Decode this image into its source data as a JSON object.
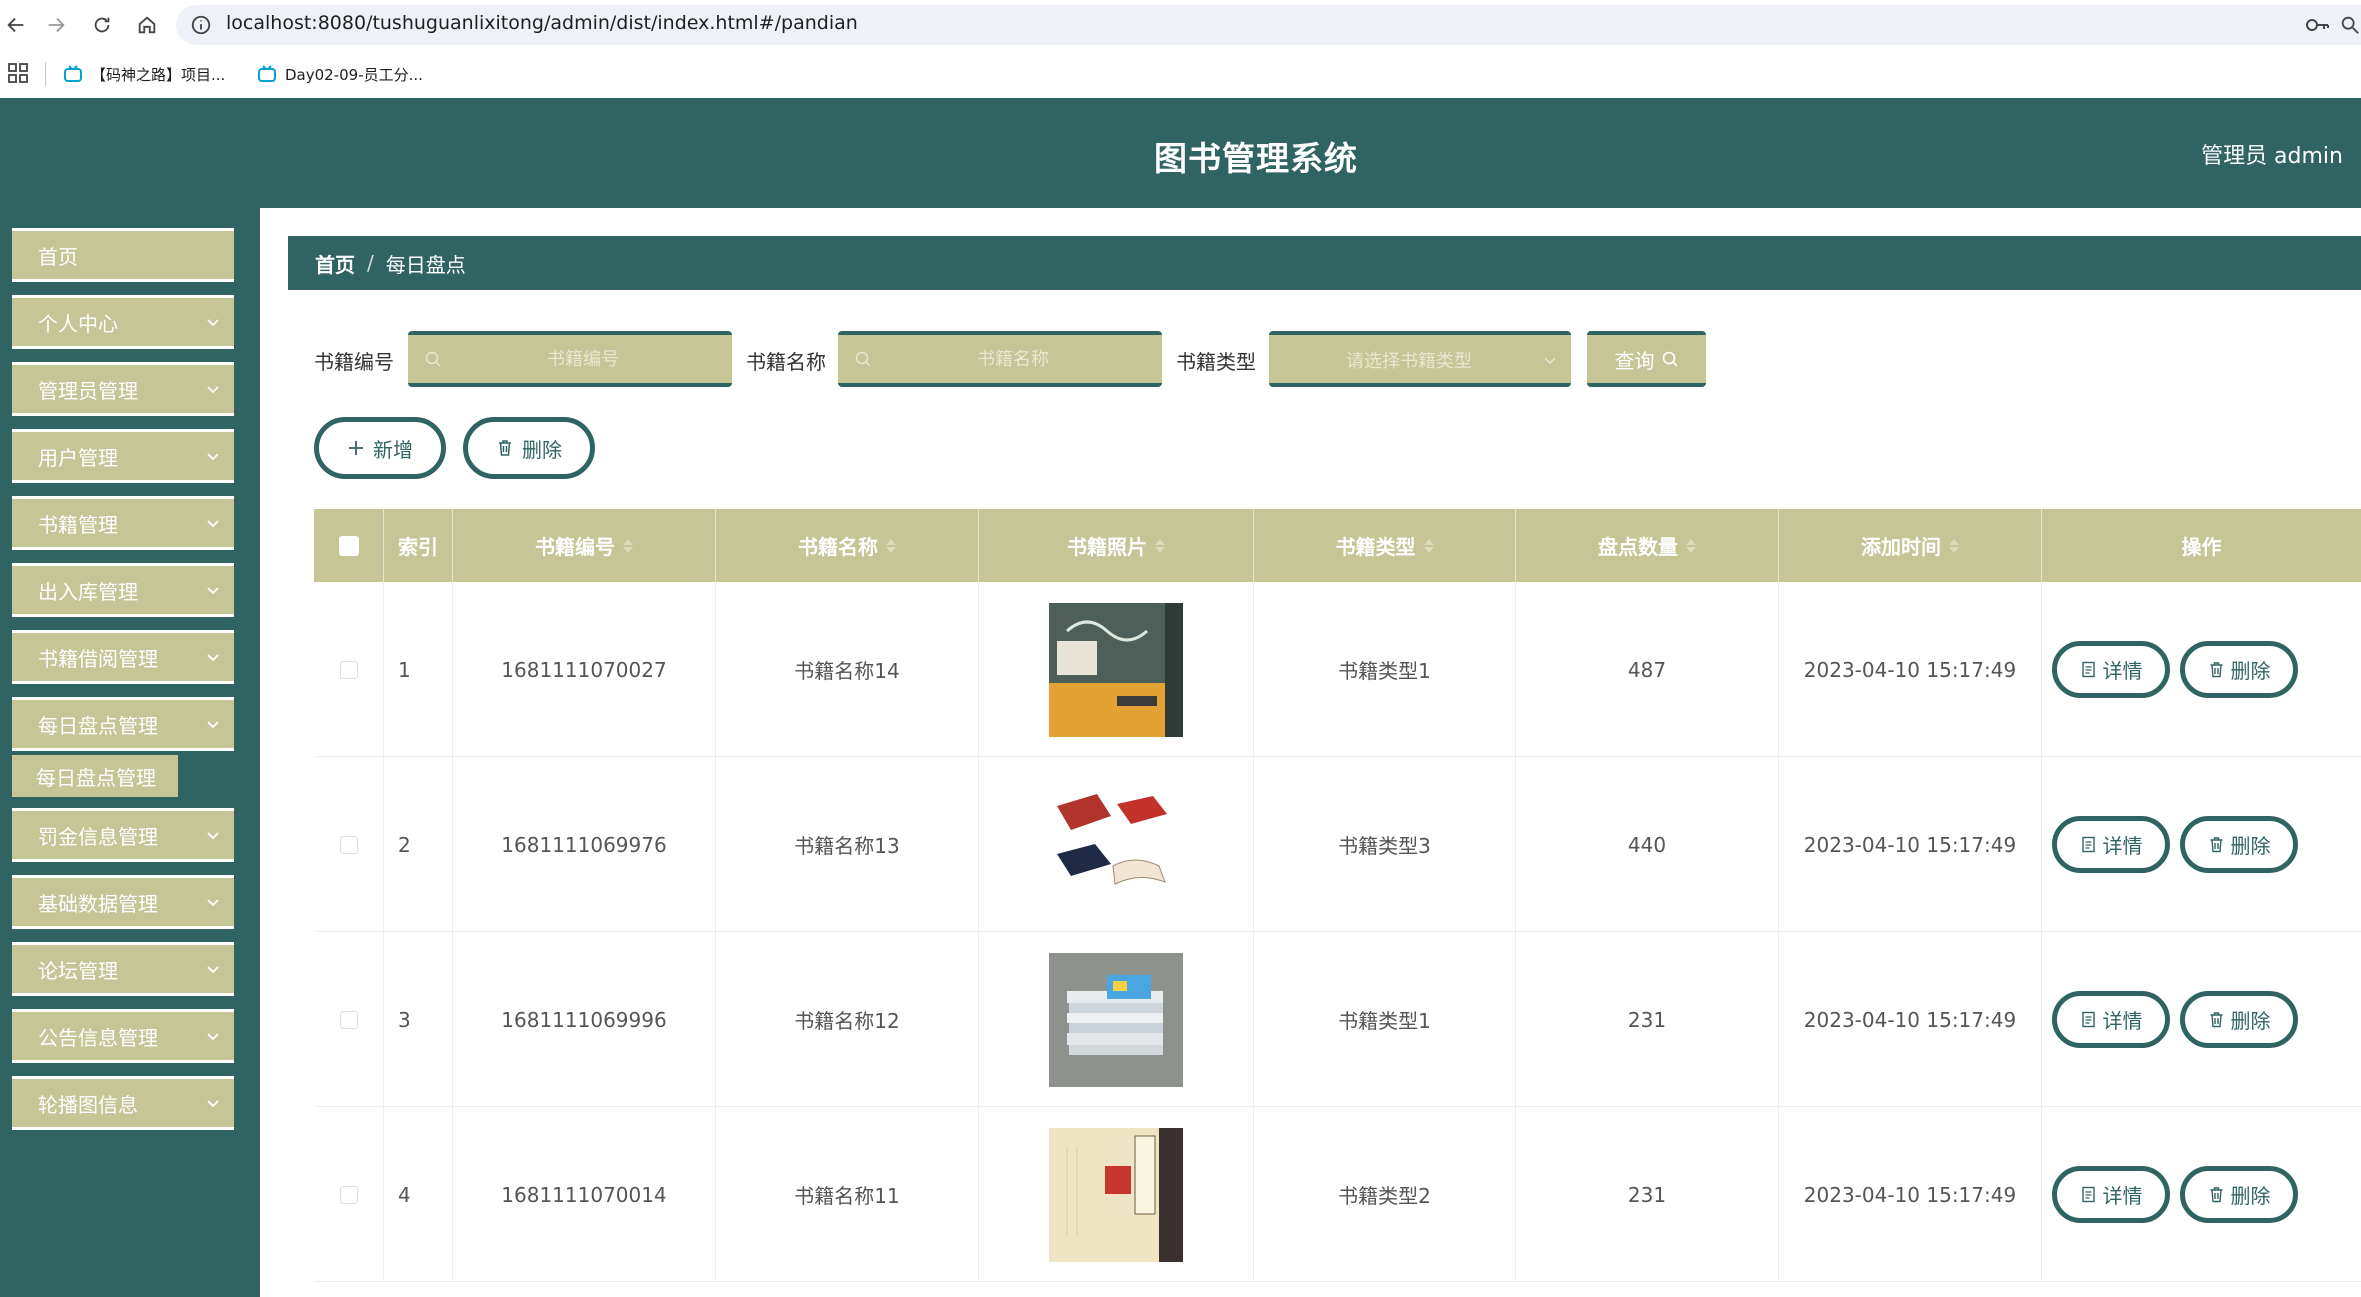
{
  "browser": {
    "url": "localhost:8080/tushuguanlixitong/admin/dist/index.html#/pandian",
    "bookmarks": [
      {
        "label": "【码神之路】项目..."
      },
      {
        "label": "Day02-09-员工分..."
      }
    ]
  },
  "header": {
    "title": "图书管理系统",
    "user": "管理员 admin"
  },
  "sidebar": {
    "items": [
      {
        "label": "首页",
        "has_children": false
      },
      {
        "label": "个人中心",
        "has_children": true
      },
      {
        "label": "管理员管理",
        "has_children": true
      },
      {
        "label": "用户管理",
        "has_children": true
      },
      {
        "label": "书籍管理",
        "has_children": true
      },
      {
        "label": "出入库管理",
        "has_children": true
      },
      {
        "label": "书籍借阅管理",
        "has_children": true
      },
      {
        "label": "每日盘点管理",
        "has_children": true
      },
      {
        "label": "罚金信息管理",
        "has_children": true
      },
      {
        "label": "基础数据管理",
        "has_children": true
      },
      {
        "label": "论坛管理",
        "has_children": true
      },
      {
        "label": "公告信息管理",
        "has_children": true
      },
      {
        "label": "轮播图信息",
        "has_children": true
      }
    ],
    "submenu": {
      "label": "每日盘点管理"
    }
  },
  "breadcrumb": {
    "home": "首页",
    "separator": "/",
    "current": "每日盘点"
  },
  "search": {
    "book_no_label": "书籍编号",
    "book_no_placeholder": "书籍编号",
    "book_name_label": "书籍名称",
    "book_name_placeholder": "书籍名称",
    "book_type_label": "书籍类型",
    "book_type_placeholder": "请选择书籍类型",
    "query_label": "查询"
  },
  "actions": {
    "add_label": "新增",
    "delete_label": "删除"
  },
  "table": {
    "headers": {
      "index": "索引",
      "book_no": "书籍编号",
      "book_name": "书籍名称",
      "book_photo": "书籍照片",
      "book_type": "书籍类型",
      "count": "盘点数量",
      "added_time": "添加时间",
      "operation": "操作"
    },
    "detail_label": "详情",
    "delete_label": "删除",
    "rows": [
      {
        "index": "1",
        "book_no": "1681111070027",
        "book_name": "书籍名称14",
        "book_type": "书籍类型1",
        "count": "487",
        "added_time": "2023-04-10 15:17:49"
      },
      {
        "index": "2",
        "book_no": "1681111069976",
        "book_name": "书籍名称13",
        "book_type": "书籍类型3",
        "count": "440",
        "added_time": "2023-04-10 15:17:49"
      },
      {
        "index": "3",
        "book_no": "1681111069996",
        "book_name": "书籍名称12",
        "book_type": "书籍类型1",
        "count": "231",
        "added_time": "2023-04-10 15:17:49"
      },
      {
        "index": "4",
        "book_no": "1681111070014",
        "book_name": "书籍名称11",
        "book_type": "书籍类型2",
        "count": "231",
        "added_time": "2023-04-10 15:17:49"
      }
    ]
  },
  "colors": {
    "primary": "#2f6462",
    "accent": "#c5c596"
  }
}
